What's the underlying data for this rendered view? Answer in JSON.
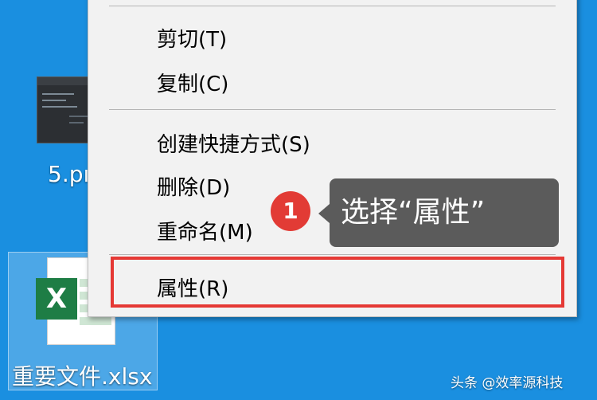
{
  "desktop": {
    "png_label": "5.pı",
    "xlsx_label": "重要文件.xlsx",
    "xlsx_badge": "X"
  },
  "context_menu": {
    "items": [
      {
        "label": "剪切(T)"
      },
      {
        "label": "复制(C)"
      },
      {
        "label": "创建快捷方式(S)"
      },
      {
        "label": "删除(D)"
      },
      {
        "label": "重命名(M)"
      },
      {
        "label": "属性(R)"
      }
    ]
  },
  "callout": {
    "step_number": "1",
    "text": "选择“属性”",
    "badge_color": "#e23b35",
    "highlight_color": "#e53935"
  },
  "watermark": "头条 @效率源科技"
}
